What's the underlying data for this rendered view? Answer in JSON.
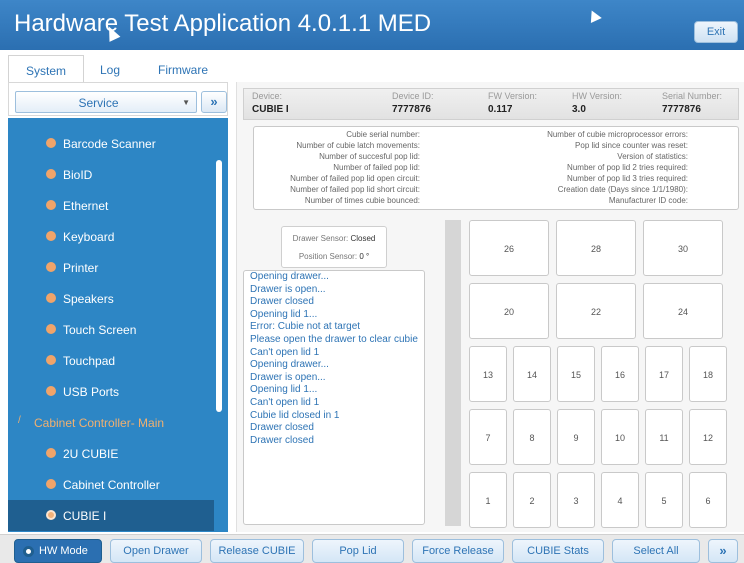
{
  "app": {
    "title": "Hardware Test Application 4.0.1.1 MED",
    "exit_label": "Exit"
  },
  "tabs": [
    "System",
    "Log",
    "Firmware"
  ],
  "service": {
    "selected": "Service",
    "go_icon": "»"
  },
  "sidebar": {
    "items": [
      {
        "label": "Barcode Scanner",
        "type": "item"
      },
      {
        "label": "BioID",
        "type": "item"
      },
      {
        "label": "Ethernet",
        "type": "item"
      },
      {
        "label": "Keyboard",
        "type": "item"
      },
      {
        "label": "Printer",
        "type": "item"
      },
      {
        "label": "Speakers",
        "type": "item"
      },
      {
        "label": "Touch Screen",
        "type": "item"
      },
      {
        "label": "Touchpad",
        "type": "item"
      },
      {
        "label": "USB Ports",
        "type": "item"
      },
      {
        "label": "Cabinet Controller- Main",
        "type": "group"
      },
      {
        "label": "2U CUBIE",
        "type": "item"
      },
      {
        "label": "Cabinet Controller",
        "type": "item"
      },
      {
        "label": "CUBIE I",
        "type": "item",
        "active": true
      }
    ]
  },
  "device": {
    "device_label": "Device:",
    "device_value": "CUBIE I",
    "id_label": "Device ID:",
    "id_value": "7777876",
    "fw_label": "FW Version:",
    "fw_value": "0.117",
    "hw_label": "HW Version:",
    "hw_value": "3.0",
    "serial_label": "Serial Number:",
    "serial_value": "7777876"
  },
  "stats": {
    "left": [
      "Cubie serial number:",
      "Number of cubie latch movements:",
      "Number of succesful pop lid:",
      "Number of failed pop lid:",
      "Number of failed pop lid open circuit:",
      "Number of failed pop lid short circuit:",
      "Number of times cubie bounced:"
    ],
    "right": [
      "Number of cubie microprocessor errors:",
      "Pop lid since counter was reset:",
      "Version of statistics:",
      "Number of pop lid 2 tries required:",
      "Number of pop lid 3 tries required:",
      "Creation date (Days since 1/1/1980):",
      "Manufacturer ID code:"
    ]
  },
  "sensors": {
    "drawer_label": "Drawer Sensor:",
    "drawer_value": "Closed",
    "position_label": "Position Sensor:",
    "position_value": "0 °"
  },
  "log": [
    "Opening drawer...",
    "Drawer is open...",
    "Drawer closed",
    "Opening lid 1...",
    "Error: Cubie not at target",
    "Please open the drawer to clear cubie",
    "Can't open lid 1",
    "Opening drawer...",
    "Drawer is open...",
    "Opening lid 1...",
    "Can't open lid 1",
    "Cubie lid closed in 1",
    "Drawer closed",
    "Drawer closed"
  ],
  "grid": {
    "row_large_1": [
      "26",
      "28",
      "30"
    ],
    "row_large_2": [
      "20",
      "22",
      "24"
    ],
    "row_small_1": [
      "13",
      "14",
      "15",
      "16",
      "17",
      "18"
    ],
    "row_small_2": [
      "7",
      "8",
      "9",
      "10",
      "11",
      "12"
    ],
    "row_small_3": [
      "1",
      "2",
      "3",
      "4",
      "5",
      "6"
    ]
  },
  "toolbar": {
    "hw_mode": "HW Mode",
    "open_drawer": "Open Drawer",
    "release_cubie": "Release CUBIE",
    "pop_lid": "Pop Lid",
    "force_release": "Force Release",
    "cubie_stats": "CUBIE Stats",
    "select_all": "Select All",
    "more": "»"
  }
}
